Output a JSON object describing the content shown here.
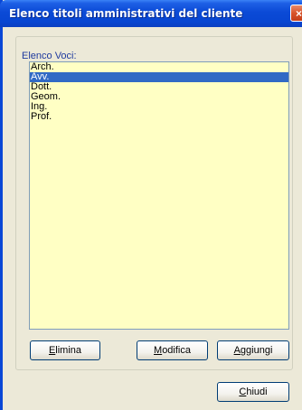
{
  "window": {
    "title": "Elenco titoli amministrativi del cliente",
    "close_symbol": "×"
  },
  "group": {
    "label": "Elenco Voci:"
  },
  "list": {
    "items": [
      "Arch.",
      "Avv.",
      "Dott.",
      "Geom.",
      "Ing.",
      "Prof."
    ],
    "selected_index": 1,
    "background_color": "#ffffc4",
    "selection_color": "#316ac5"
  },
  "buttons": {
    "elimina": {
      "mnemonic": "E",
      "rest": "limina"
    },
    "modifica": {
      "mnemonic": "M",
      "rest": "odifica"
    },
    "aggiungi": {
      "mnemonic": "A",
      "rest": "ggiungi"
    },
    "chiudi": {
      "mnemonic": "C",
      "rest": "hiudi"
    }
  }
}
